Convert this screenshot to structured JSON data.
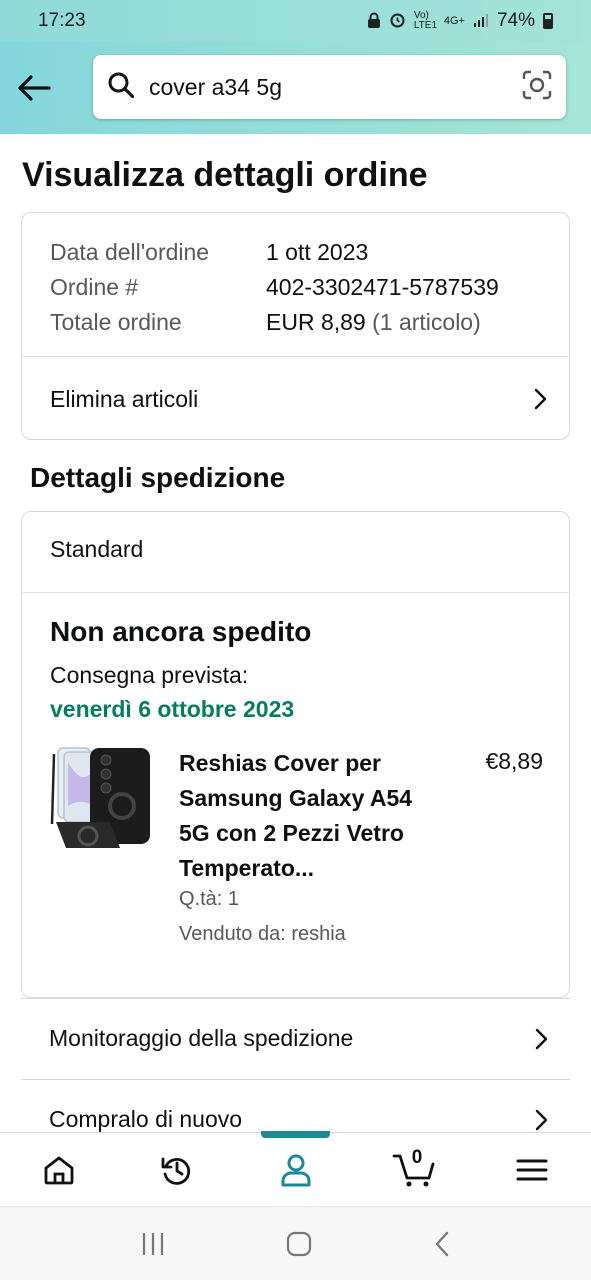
{
  "status_bar": {
    "time": "17:23",
    "network": "4G+",
    "volte": "Vo) LTE1",
    "battery": "74%"
  },
  "header": {
    "search_query": "cover a34 5g",
    "icons": [
      "back-arrow-icon",
      "search-icon",
      "camera-lens-icon"
    ]
  },
  "page": {
    "title": "Visualizza dettagli ordine"
  },
  "order_summary": {
    "rows": [
      {
        "label": "Data dell'ordine",
        "value": "1 ott 2023",
        "sub": ""
      },
      {
        "label": "Ordine #",
        "value": "402-3302471-5787539",
        "sub": ""
      },
      {
        "label": "Totale ordine",
        "value": "EUR 8,89",
        "sub": "(1 articolo)"
      }
    ],
    "delete_items_label": "Elimina articoli"
  },
  "shipment": {
    "section_title": "Dettagli spedizione",
    "method": "Standard",
    "status": "Non ancora spedito",
    "delivery_label": "Consegna prevista:",
    "delivery_date": "venerdì 6 ottobre 2023",
    "product": {
      "title": "Reshias Cover per Samsung Galaxy A54 5G con 2 Pezzi Vetro Temperato...",
      "price": "€8,89",
      "qty": "Q.tà: 1",
      "seller": "Venduto da: reshia"
    }
  },
  "actions": {
    "track_label": "Monitoraggio della spedizione",
    "buy_again_label": "Compralo di nuovo"
  },
  "bottom_nav": {
    "items": [
      "home-icon",
      "history-icon",
      "account-icon",
      "cart-icon",
      "menu-icon"
    ],
    "active": "account-icon",
    "cart_count": "0"
  },
  "colors": {
    "header_start": "#84d6da",
    "header_end": "#a6e5d6",
    "delivery_green": "#067d62",
    "active_teal": "#1a8a99"
  }
}
